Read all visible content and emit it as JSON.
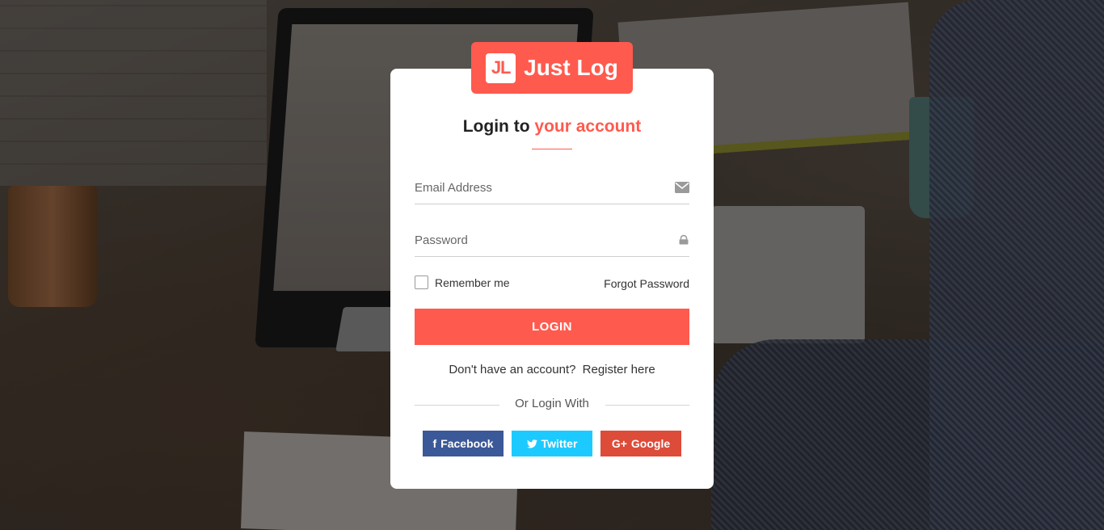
{
  "brand": {
    "mark": "JL",
    "name": "Just Log",
    "color": "#ff5a4e"
  },
  "heading": {
    "prefix": "Login to",
    "accent": "your account"
  },
  "form": {
    "email_placeholder": "Email Address",
    "email_icon": "envelope-icon",
    "password_placeholder": "Password",
    "password_icon": "lock-icon",
    "remember_label": "Remember me",
    "remember_checked": false,
    "forgot_label": "Forgot Password",
    "login_label": "LOGIN"
  },
  "register": {
    "prompt": "Don't have an account?",
    "link": "Register here"
  },
  "social": {
    "divider_text": "Or Login With",
    "buttons": [
      {
        "label": "Facebook",
        "icon": "facebook-icon",
        "glyph": "f",
        "color": "#3b5998"
      },
      {
        "label": "Twitter",
        "icon": "twitter-icon",
        "glyph": "🐦",
        "color": "#1dcaff"
      },
      {
        "label": "Google",
        "icon": "google-plus-icon",
        "glyph": "G+",
        "color": "#dd4b39"
      }
    ]
  }
}
